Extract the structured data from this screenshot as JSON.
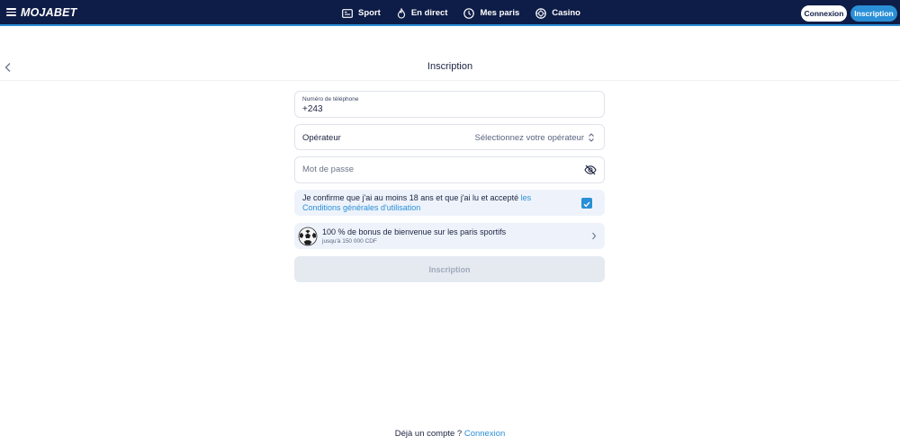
{
  "header": {
    "logo": "MOJABET",
    "nav": [
      {
        "label": "Sport",
        "icon": "sport-ticket-icon"
      },
      {
        "label": "En direct",
        "icon": "live-flame-icon"
      },
      {
        "label": "Mes paris",
        "icon": "clock-icon"
      },
      {
        "label": "Casino",
        "icon": "casino-chip-icon"
      }
    ],
    "login_label": "Connexion",
    "register_label": "Inscription"
  },
  "page": {
    "title": "Inscription"
  },
  "form": {
    "phone_label": "Numéro de téléphone",
    "phone_value": "+243",
    "operator_label": "Opérateur",
    "operator_value": "Sélectionnez votre opérateur",
    "password_placeholder": "Mot de passe",
    "terms_text": "Je confirme que j'ai au moins 18 ans et que j'ai lu et accepté ",
    "terms_link": "les Conditions générales d'utilisation",
    "terms_checked": true,
    "bonus_title": "100 % de bonus de bienvenue sur les paris sportifs",
    "bonus_subtitle": "jusqu'à 150 000 CDF",
    "submit_label": "Inscription"
  },
  "footer": {
    "text": "Déjà un compte ? ",
    "link": "Connexion"
  },
  "colors": {
    "header_bg": "#0e1d47",
    "accent": "#2a8fd6",
    "panel_bg": "#eef3fb",
    "disabled_bg": "#e5eaf1"
  }
}
